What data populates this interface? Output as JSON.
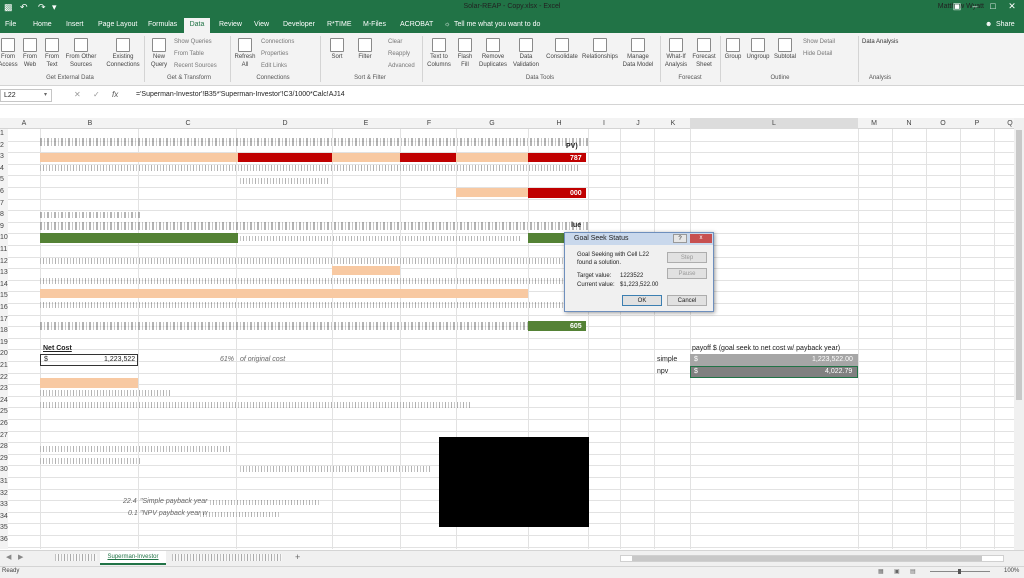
{
  "window": {
    "title": "Solar-REAP - Copy.xlsx - Excel",
    "user": "Matthew Wyatt",
    "share": "Share"
  },
  "tabs": [
    "File",
    "Home",
    "Insert",
    "Page Layout",
    "Formulas",
    "Data",
    "Review",
    "View",
    "Developer",
    "R*TIME",
    "M-Files",
    "ACROBAT"
  ],
  "tell_me": "Tell me what you want to do",
  "ribbon": {
    "ext": {
      "from_access": "From Access",
      "from_web": "From Web",
      "from_text": "From Text",
      "from_other": "From Other Sources",
      "existing": "Existing Connections",
      "group": "Get External Data"
    },
    "gt": {
      "new_query": "New Query",
      "show_queries": "Show Queries",
      "from_table": "From Table",
      "recent_sources": "Recent Sources",
      "group": "Get & Transform"
    },
    "conn": {
      "refresh_all": "Refresh All",
      "connections": "Connections",
      "properties": "Properties",
      "edit_links": "Edit Links",
      "group": "Connections"
    },
    "sort": {
      "sort": "Sort",
      "filter": "Filter",
      "clear": "Clear",
      "reapply": "Reapply",
      "advanced": "Advanced",
      "group": "Sort & Filter"
    },
    "tools": {
      "text_to_columns": "Text to Columns",
      "flash_fill": "Flash Fill",
      "remove_duplicates": "Remove Duplicates",
      "data_validation": "Data Validation",
      "consolidate": "Consolidate",
      "relationships": "Relationships",
      "manage_data_model": "Manage Data Model",
      "group": "Data Tools"
    },
    "forecast": {
      "what_if": "What-If Analysis",
      "forecast_sheet": "Forecast Sheet",
      "group": "Forecast"
    },
    "outline": {
      "group_btn": "Group",
      "ungroup": "Ungroup",
      "subtotal": "Subtotal",
      "show_detail": "Show Detail",
      "hide_detail": "Hide Detail",
      "group": "Outline"
    },
    "analysis": {
      "data_analysis": "Data Analysis",
      "group": "Analysis"
    }
  },
  "formula_bar": {
    "name_box": "L22",
    "fx": "fx",
    "formula": "='Superman-Investor'!B35*'Superman-Investor'!C3/1000*Calc!AJ14"
  },
  "columns": [
    "A",
    "B",
    "C",
    "D",
    "E",
    "F",
    "G",
    "H",
    "I",
    "J",
    "K",
    "L",
    "M",
    "N",
    "O",
    "P",
    "Q"
  ],
  "rows": [
    "1",
    "2",
    "3",
    "4",
    "5",
    "6",
    "7",
    "8",
    "9",
    "10",
    "11",
    "12",
    "13",
    "14",
    "15",
    "16",
    "17",
    "18",
    "19",
    "20",
    "21",
    "22",
    "23",
    "24",
    "25",
    "26",
    "27",
    "28",
    "29",
    "30",
    "31",
    "32",
    "33",
    "34",
    "35",
    "36"
  ],
  "cells": {
    "pv_label": "PV)",
    "h2_val": "787",
    "h5_val": "000",
    "h9_label": "lue",
    "h17_val": "605",
    "net_cost_label": "Net Cost",
    "net_cost_currency": "$",
    "net_cost_value": "1,223,522",
    "pct_value": "61%",
    "pct_label": "of original cost",
    "payoff_header": "payoff $  (goal seek to net cost w/ payback year)",
    "simple_label": "simple",
    "simple_currency": "$",
    "simple_value": "1,223,522.00",
    "npv_label": "npv",
    "npv_currency": "$",
    "npv_value": "4,022.79",
    "simple_payback_num": "22.4",
    "simple_payback_label": "\"Simple payback year",
    "npv_payback_num": "0.1",
    "npv_payback_label": "\"NPV payback year w"
  },
  "dialog": {
    "title": "Goal Seek Status",
    "help": "?",
    "close": "x",
    "line1": "Goal Seeking with Cell L22",
    "line2": "found a solution.",
    "target_label": "Target value:",
    "target_value": "1223522",
    "current_label": "Current value:",
    "current_value": "$1,223,522.00",
    "step": "Step",
    "pause": "Pause",
    "ok": "OK",
    "cancel": "Cancel"
  },
  "sheet_tabs": {
    "active": "Superman-Investor",
    "add": "+"
  },
  "status": {
    "ready": "Ready",
    "zoom": "100%"
  }
}
